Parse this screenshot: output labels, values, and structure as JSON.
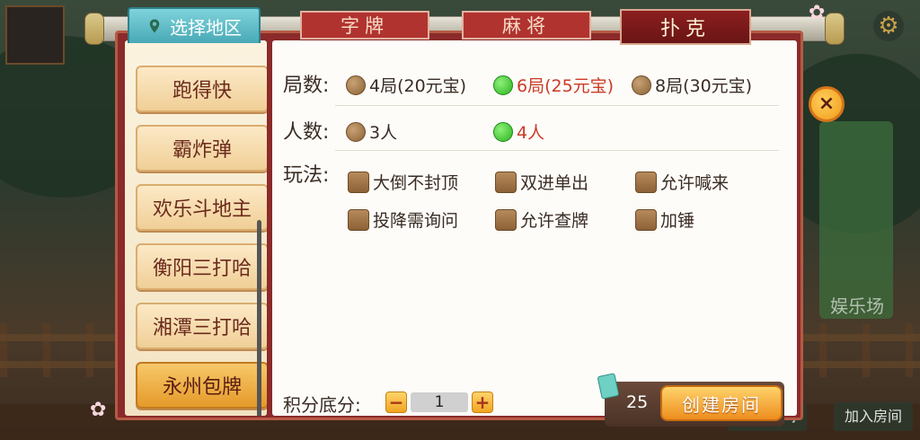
{
  "background": {
    "right_label": "娱乐场",
    "bottom_create": "创建房间",
    "bottom_join": "加入房间"
  },
  "tabs": {
    "region": "选择地区",
    "items": [
      "字牌",
      "麻将",
      "扑克"
    ],
    "active": "扑克"
  },
  "sidebar": {
    "items": [
      "跑得快",
      "霸炸弹",
      "欢乐斗地主",
      "衡阳三打哈",
      "湘潭三打哈",
      "永州包牌"
    ],
    "active": "永州包牌"
  },
  "rounds": {
    "label": "局数:",
    "options": [
      {
        "text": "4局(20元宝)",
        "selected": false
      },
      {
        "text": "6局(25元宝)",
        "selected": true
      },
      {
        "text": "8局(30元宝)",
        "selected": false
      }
    ]
  },
  "players": {
    "label": "人数:",
    "options": [
      {
        "text": "3人",
        "selected": false
      },
      {
        "text": "4人",
        "selected": true
      }
    ]
  },
  "rules": {
    "label": "玩法:",
    "options": [
      "大倒不封顶",
      "双进单出",
      "允许喊来",
      "投降需询问",
      "允许查牌",
      "加锤"
    ]
  },
  "score": {
    "label": "积分底分:",
    "minus": "−",
    "plus": "+",
    "value": "1"
  },
  "create": {
    "cost": "25",
    "label": "创建房间"
  },
  "close_icon": "×",
  "colors": {
    "selected_text": "#cc3a26",
    "frame": "#8b2a2a",
    "accent_orange": "#ed8d1d"
  }
}
